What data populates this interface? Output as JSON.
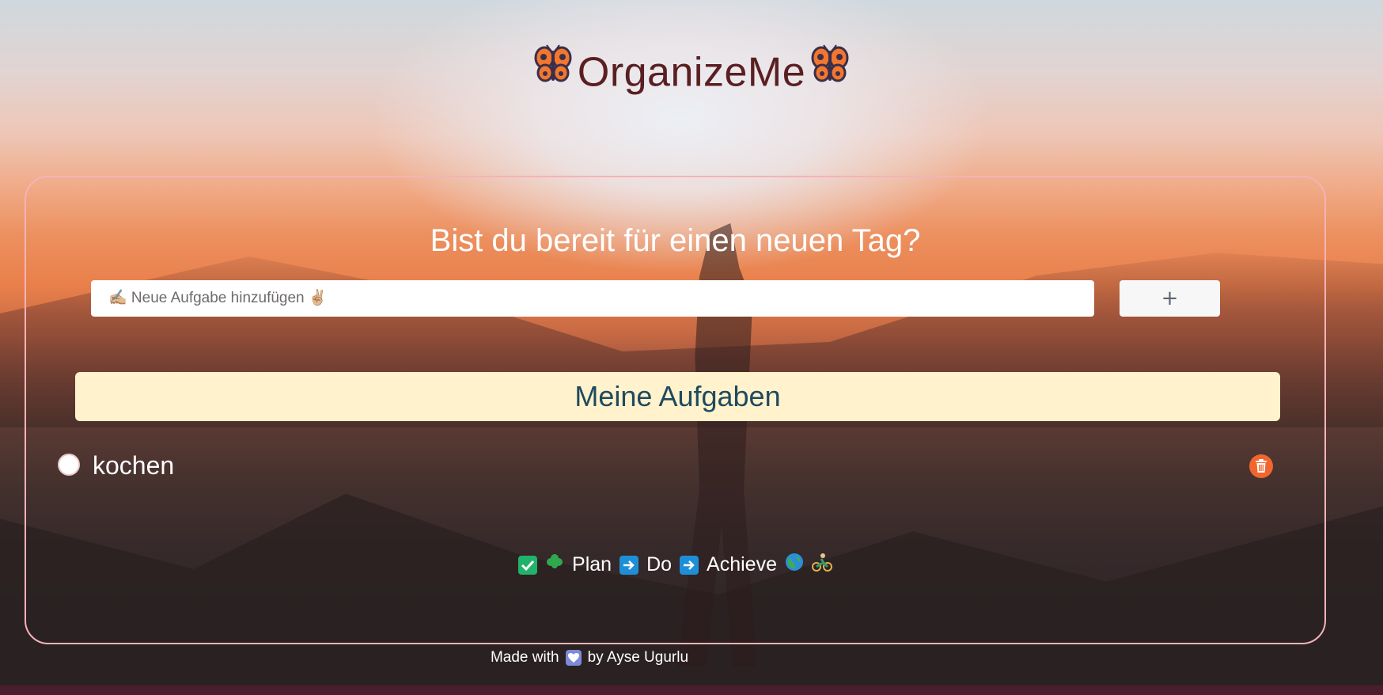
{
  "header": {
    "title": "OrganizeMe",
    "left_icon": "butterfly-icon",
    "right_icon": "butterfly-icon"
  },
  "card": {
    "heading": "Bist du bereit für einen neuen Tag?",
    "input": {
      "placeholder": "✍🏼 Neue Aufgabe hinzufügen ✌🏼",
      "value": ""
    },
    "add_button_label": "+",
    "section_title": "Meine Aufgaben",
    "tasks": [
      {
        "text": "kochen",
        "done": false,
        "delete_icon": "trash-icon"
      }
    ],
    "tagline": {
      "plan": "Plan",
      "do": "Do",
      "achieve": "Achieve",
      "icons": [
        "check-mark-icon",
        "clover-icon",
        "arrow-right-icon",
        "arrow-right-icon",
        "globe-icon",
        "cyclist-icon"
      ]
    }
  },
  "footer": {
    "prefix": "Made with",
    "suffix": "by Ayse Ugurlu",
    "icon": "heart-icon"
  },
  "colors": {
    "title": "#5a1f22",
    "card_border": "#f4b3b8",
    "section_bar": "#fff2cd",
    "section_text": "#1f4a5e",
    "delete": "#f2662e",
    "bottom_strip": "#8a1b4e"
  }
}
